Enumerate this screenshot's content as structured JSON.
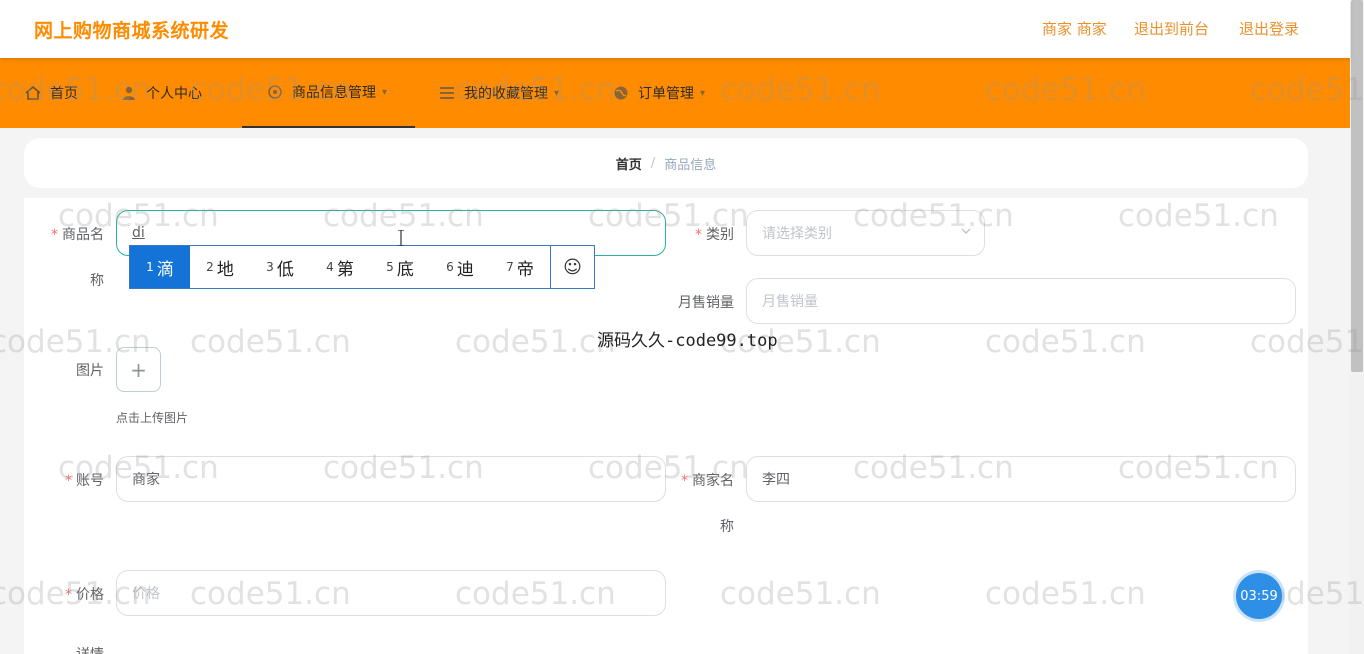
{
  "header": {
    "brand": "网上购物商城系统研发",
    "links": [
      "商家 商家",
      "退出到前台",
      "退出登录"
    ]
  },
  "nav": {
    "items": [
      {
        "label": "首页",
        "icon": "home-icon"
      },
      {
        "label": "个人中心",
        "icon": "user-icon"
      },
      {
        "label": "商品信息管理",
        "icon": "goods-icon"
      },
      {
        "label": "我的收藏管理",
        "icon": "grid-icon"
      },
      {
        "label": "订单管理",
        "icon": "globe-icon"
      }
    ]
  },
  "breadcrumb": {
    "home": "首页",
    "separator": "/",
    "current": "商品信息"
  },
  "form": {
    "name_label_1": "商品名",
    "name_label_2": "称",
    "name_value": "di",
    "category_label": "类别",
    "category_placeholder": "请选择类别",
    "sales_label": "月售销量",
    "sales_placeholder": "月售销量",
    "image_label": "图片",
    "upload_plus": "+",
    "upload_tip": "点击上传图片",
    "account_label": "账号",
    "account_value": "商家",
    "merchant_label_1": "商家名",
    "merchant_label_2": "称",
    "merchant_value": "李四",
    "price_label": "价格",
    "price_placeholder": "价格",
    "detail_label": "详情",
    "required_mark": "*"
  },
  "ime": {
    "candidates": [
      {
        "num": "1",
        "char": "滴"
      },
      {
        "num": "2",
        "char": "地"
      },
      {
        "num": "3",
        "char": "低"
      },
      {
        "num": "4",
        "char": "第"
      },
      {
        "num": "5",
        "char": "底"
      },
      {
        "num": "6",
        "char": "迪"
      },
      {
        "num": "7",
        "char": "帝"
      }
    ],
    "emoji": "☺"
  },
  "watermark": "code51.cn",
  "overlay_text": "源码久久-code99.top",
  "timer": "03:59",
  "colors": {
    "brand": "#ff8c00",
    "focus": "#2ab3a0",
    "ime_selected": "#1473d6"
  }
}
